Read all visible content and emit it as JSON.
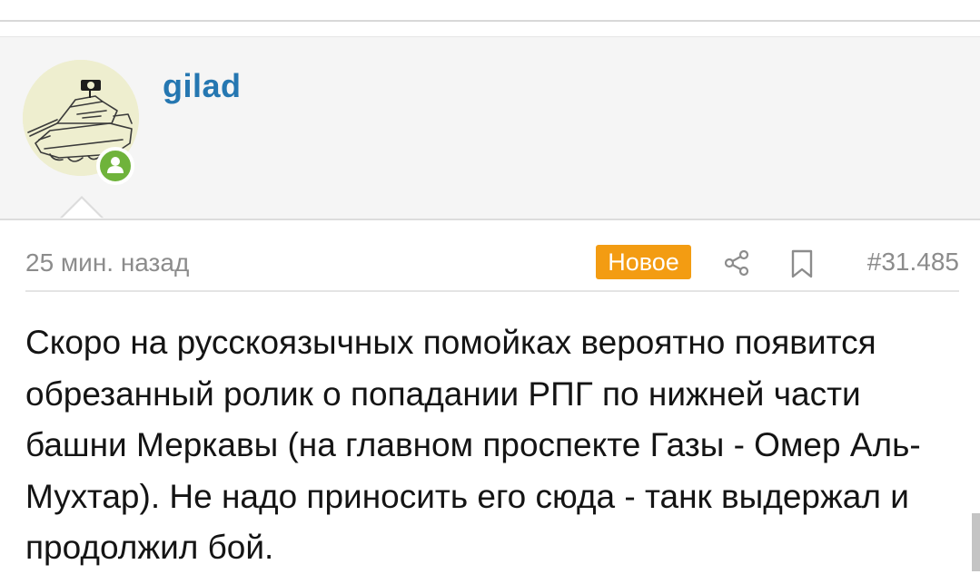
{
  "post": {
    "author": "gilad",
    "online": true,
    "time": "25 мин. назад",
    "new_badge": "Новое",
    "post_number": "#31.485",
    "body": "Скоро на русскоязычных помойках вероятно появится обрезанный ролик о попадании РПГ по нижней части башни Меркавы (на главном проспекте Газы - Омер Аль-Мухтар). Не надо приносить его сюда - танк выдержал и продолжил бой."
  },
  "colors": {
    "username": "#2577b1",
    "badge": "#f39c12",
    "online": "#6fb33b",
    "meta_text": "#8c8c8c"
  },
  "icons": {
    "share": "share-icon",
    "bookmark": "bookmark-icon",
    "online": "user-online-icon"
  }
}
